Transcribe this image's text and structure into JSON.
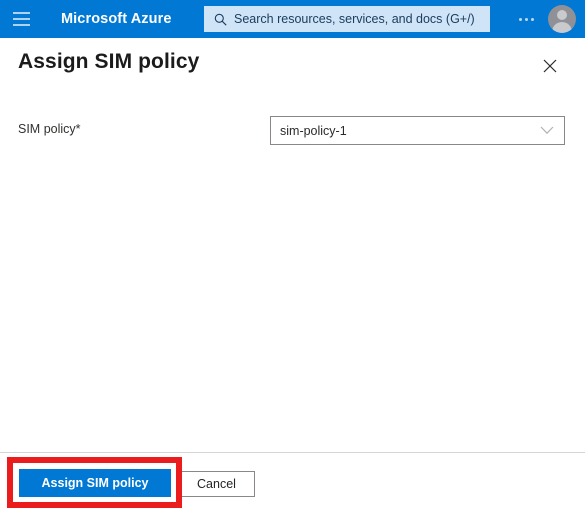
{
  "topbar": {
    "menu_icon": "hamburger-icon",
    "brand": "Microsoft Azure",
    "search": {
      "icon": "search-icon",
      "placeholder": "Search resources, services, and docs (G+/)",
      "value": ""
    },
    "more_icon": "ellipsis-icon",
    "avatar_icon": "user-avatar-icon",
    "background_color": "#0078d4",
    "search_background_color": "#cfe4f7"
  },
  "blade": {
    "title": "Assign SIM policy",
    "close_icon": "close-icon"
  },
  "form": {
    "fields": [
      {
        "label": "SIM policy",
        "required_marker": "*",
        "control": "dropdown",
        "value": "sim-policy-1",
        "chevron_icon": "chevron-down-icon"
      }
    ]
  },
  "footer": {
    "primary_button": {
      "label": "Assign SIM policy",
      "color": "#0078d4"
    },
    "secondary_button": {
      "label": "Cancel"
    }
  },
  "annotation": {
    "type": "highlight-rectangle",
    "color": "#ea1c1c",
    "target": "Assign SIM policy"
  }
}
